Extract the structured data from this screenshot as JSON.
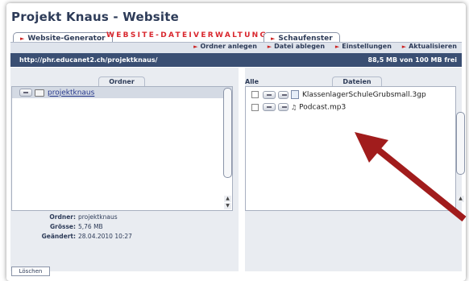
{
  "app": {
    "title": "Projekt Knaus - Website"
  },
  "tabs": [
    {
      "label": "Website-Generator"
    },
    {
      "label": "WEBSITE-DATEIVERWALTUNG",
      "active": true
    },
    {
      "label": "Schaufenster"
    }
  ],
  "toolbar": {
    "actions": [
      {
        "label": "Ordner anlegen"
      },
      {
        "label": "Datei ablegen"
      },
      {
        "label": "Einstellungen"
      },
      {
        "label": "Aktualisieren"
      }
    ]
  },
  "pathbar": {
    "path": "http://phr.educanet2.ch/projektknaus/",
    "quota": "88,5 MB von 100 MB frei"
  },
  "folders": {
    "tab_label": "Ordner",
    "items": [
      {
        "name": "projektknaus"
      }
    ],
    "info": {
      "folder_key": "Ordner:",
      "folder_value": "projektknaus",
      "size_key": "Grösse:",
      "size_value": "5,76 MB",
      "changed_key": "Geändert:",
      "changed_value": "28.04.2010 10:27"
    }
  },
  "files": {
    "select_all_label": "Alle",
    "tab_label": "Dateien",
    "items": [
      {
        "name": "KlassenlagerSchuleGrubsmall.3gp",
        "icon": "file-icon"
      },
      {
        "name": "Podcast.mp3",
        "icon": "audio-file-icon"
      }
    ]
  },
  "bottom": {
    "button_label": "Löschen"
  },
  "colors": {
    "accent_red": "#d9272e",
    "navy": "#2d3b58",
    "pathbar": "#3a4f73",
    "arrow": "#a11c1c"
  }
}
